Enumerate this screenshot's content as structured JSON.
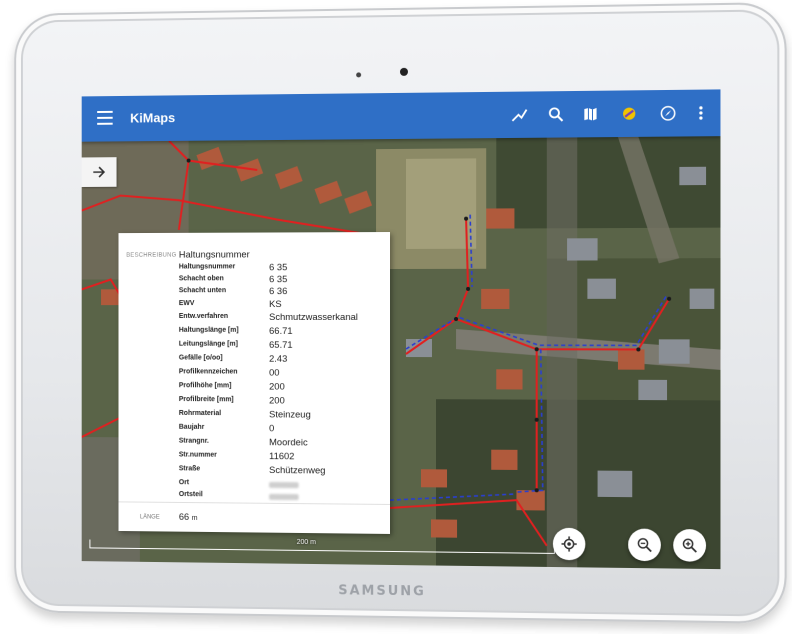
{
  "device": {
    "brand": "SAMSUNG"
  },
  "app": {
    "title": "KiMaps"
  },
  "toolbar": {
    "icons": [
      "measure-icon",
      "search-icon",
      "map-icon",
      "layers-icon",
      "navigation-icon",
      "more-vert-icon"
    ]
  },
  "panel": {
    "section_label": "BESCHREIBUNG",
    "heading": "Haltungsnummer",
    "rows": [
      {
        "key": "Haltungsnummer",
        "value": "6 35"
      },
      {
        "key": "Schacht oben",
        "value": "6 35"
      },
      {
        "key": "Schacht unten",
        "value": "6 36"
      },
      {
        "key": "EWV",
        "value": "KS"
      },
      {
        "key": "Entw.verfahren",
        "value": "Schmutzwasserkanal"
      },
      {
        "key": "Haltungslänge [m]",
        "value": "66.71"
      },
      {
        "key": "Leitungslänge [m]",
        "value": "65.71"
      },
      {
        "key": "Gefälle [o/oo]",
        "value": "2.43"
      },
      {
        "key": "Profilkennzeichen",
        "value": "00"
      },
      {
        "key": "Profilhöhe [mm]",
        "value": "200"
      },
      {
        "key": "Profilbreite [mm]",
        "value": "200"
      },
      {
        "key": "Rohrmaterial",
        "value": "Steinzeug"
      },
      {
        "key": "Baujahr",
        "value": "0"
      },
      {
        "key": "Strangnr.",
        "value": "Moordeic"
      },
      {
        "key": "Str.nummer",
        "value": "11602"
      },
      {
        "key": "Straße",
        "value": "Schützenweg"
      },
      {
        "key": "Ort",
        "value": null
      },
      {
        "key": "Ortsteil",
        "value": null
      }
    ],
    "length_label": "LÄNGE",
    "length_value": "66",
    "length_unit": "m"
  },
  "map": {
    "scale_label": "200 m"
  },
  "colors": {
    "appbar": "#2f6fc6",
    "pipe_red": "#e02020",
    "pipe_blue": "#2a3fcf"
  }
}
